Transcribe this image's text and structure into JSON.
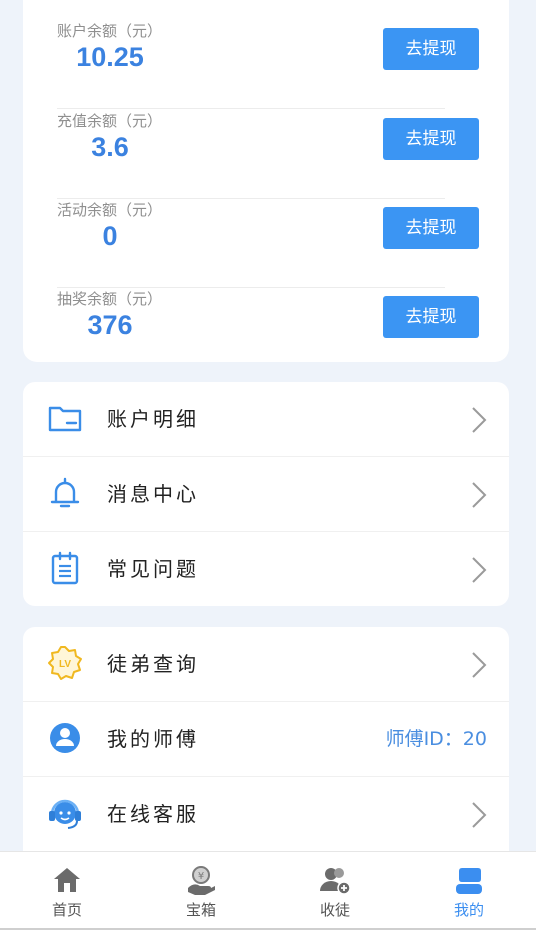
{
  "balances": [
    {
      "label": "账户余额（元）",
      "value": "10.25",
      "button": "去提现"
    },
    {
      "label": "充值余额（元）",
      "value": "3.6",
      "button": "去提现"
    },
    {
      "label": "活动余额（元）",
      "value": "0",
      "button": "去提现"
    },
    {
      "label": "抽奖余额（元）",
      "value": "376",
      "button": "去提现"
    }
  ],
  "menu1": [
    {
      "label": "账户明细",
      "icon": "folder-icon"
    },
    {
      "label": "消息中心",
      "icon": "bell-icon"
    },
    {
      "label": "常见问题",
      "icon": "clipboard-icon"
    }
  ],
  "menu2": [
    {
      "label": "徒弟查询",
      "icon": "lv-badge-icon"
    },
    {
      "label": "我的师傅",
      "icon": "user-icon",
      "value": "师傅ID：20"
    },
    {
      "label": "在线客服",
      "icon": "headset-icon"
    }
  ],
  "tabs": [
    {
      "label": "首页",
      "icon": "home-icon"
    },
    {
      "label": "宝箱",
      "icon": "treasure-icon"
    },
    {
      "label": "收徒",
      "icon": "add-friend-icon"
    },
    {
      "label": "我的",
      "icon": "profile-icon",
      "active": true
    }
  ],
  "colors": {
    "accent": "#3b95f3",
    "value_blue": "#3b82e0",
    "background": "#eef3fa"
  }
}
